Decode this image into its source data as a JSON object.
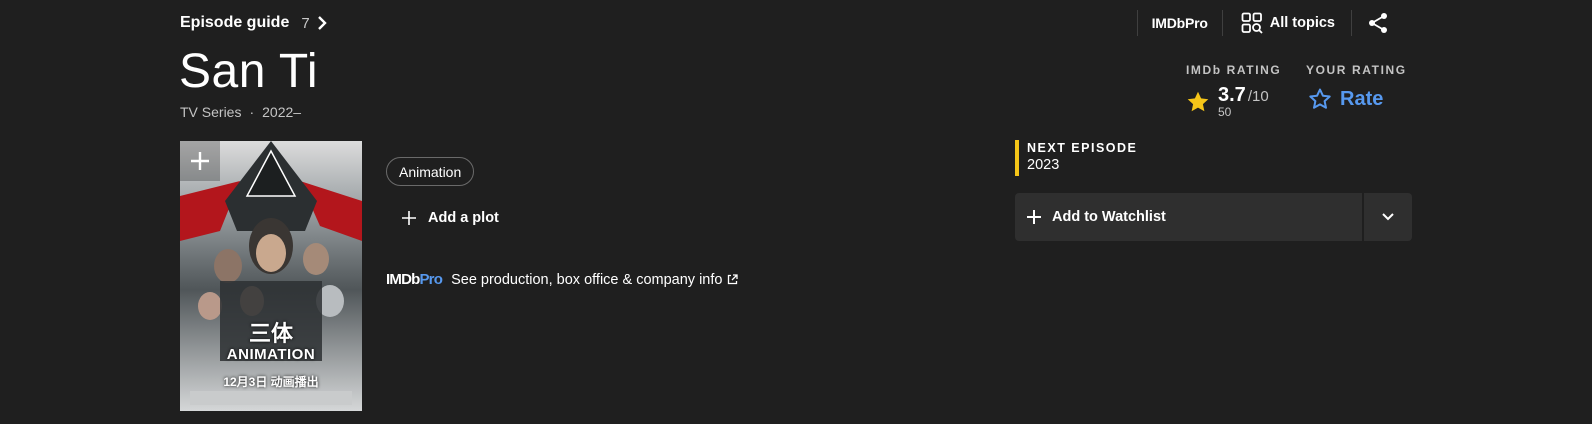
{
  "header": {
    "episode_guide_label": "Episode guide",
    "episode_count": "7",
    "imdbpro_label": "IMDbPro",
    "all_topics_label": "All topics"
  },
  "title": {
    "name": "San Ti",
    "type": "TV Series",
    "separator": "·",
    "years": "2022–"
  },
  "ratings": {
    "imdb_header": "IMDb RATING",
    "value": "3.7",
    "max": "/10",
    "count": "50",
    "your_header": "YOUR RATING",
    "rate_label": "Rate",
    "star_color": "#f5c518",
    "rate_color": "#5799ef"
  },
  "poster": {
    "title_cn": "三体",
    "title_en": "ANIMATION",
    "date_cn": "12月3日 动画播出"
  },
  "genres": [
    "Animation"
  ],
  "plot": {
    "add_label": "Add a plot"
  },
  "imdbpro": {
    "logo_main": "IMDb",
    "logo_pro": "Pro",
    "link_text": "See production, box office & company info"
  },
  "next_episode": {
    "label": "NEXT EPISODE",
    "value": "2023",
    "accent": "#f5c518"
  },
  "watchlist": {
    "label": "Add to Watchlist"
  },
  "icons": [
    "chevron-right-icon",
    "topics-grid-icon",
    "share-icon",
    "star-filled-icon",
    "star-outline-icon",
    "plus-icon",
    "external-link-icon",
    "chevron-down-icon"
  ]
}
